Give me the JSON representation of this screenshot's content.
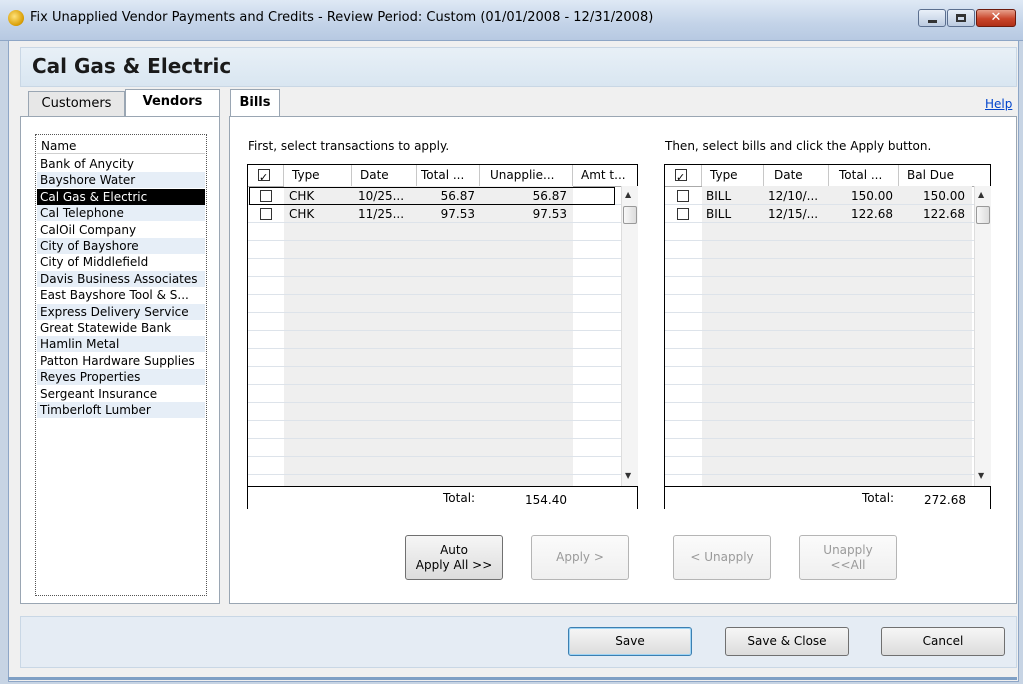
{
  "window": {
    "title": "Fix Unapplied Vendor Payments and Credits - Review Period: Custom (01/01/2008 - 12/31/2008)",
    "close_glyph": "✕"
  },
  "heading": "Cal Gas & Electric",
  "left_tabs": {
    "customers": "Customers",
    "vendors": "Vendors"
  },
  "vendor_list": {
    "header": "Name",
    "items": [
      "Bank of Anycity",
      "Bayshore Water",
      "Cal Gas & Electric",
      "Cal Telephone",
      "CalOil Company",
      "City of Bayshore",
      "City of Middlefield",
      "Davis Business Associates",
      "East Bayshore Tool & S...",
      "Express Delivery Service",
      "Great Statewide Bank",
      "Hamlin Metal",
      "Patton Hardware Supplies",
      "Reyes Properties",
      "Sergeant Insurance",
      "Timberloft Lumber"
    ],
    "selected_index": 2
  },
  "bills_tab": "Bills",
  "help": "Help",
  "transactions": {
    "instruction": "First, select transactions to apply.",
    "columns": [
      "Type",
      "Date",
      "Total ...",
      "Unapplie...",
      "Amt t..."
    ],
    "rows": [
      {
        "type": "CHK",
        "date": "10/25...",
        "total": "56.87",
        "unapplied": "56.87",
        "amt": ""
      },
      {
        "type": "CHK",
        "date": "11/25...",
        "total": "97.53",
        "unapplied": "97.53",
        "amt": ""
      }
    ],
    "total_label": "Total:",
    "total_value": "154.40"
  },
  "bills": {
    "instruction": "Then, select bills and click the Apply button.",
    "columns": [
      "Type",
      "Date",
      "Total ...",
      "Bal Due"
    ],
    "rows": [
      {
        "type": "BILL",
        "date": "12/10/...",
        "total": "150.00",
        "bal_due": "150.00"
      },
      {
        "type": "BILL",
        "date": "12/15/...",
        "total": "122.68",
        "bal_due": "122.68"
      }
    ],
    "total_label": "Total:",
    "total_value": "272.68"
  },
  "action_buttons": {
    "auto_apply_line1": "Auto",
    "auto_apply_line2": "Apply All >>",
    "apply": "Apply >",
    "unapply": "< Unapply",
    "unapply_all_line1": "Unapply",
    "unapply_all_line2": "<<All"
  },
  "footer": {
    "save": "Save",
    "save_close": "Save & Close",
    "cancel": "Cancel"
  },
  "icons": {
    "app": "quickbooks-icon",
    "scroll_up": "▲",
    "scroll_down": "▼"
  }
}
